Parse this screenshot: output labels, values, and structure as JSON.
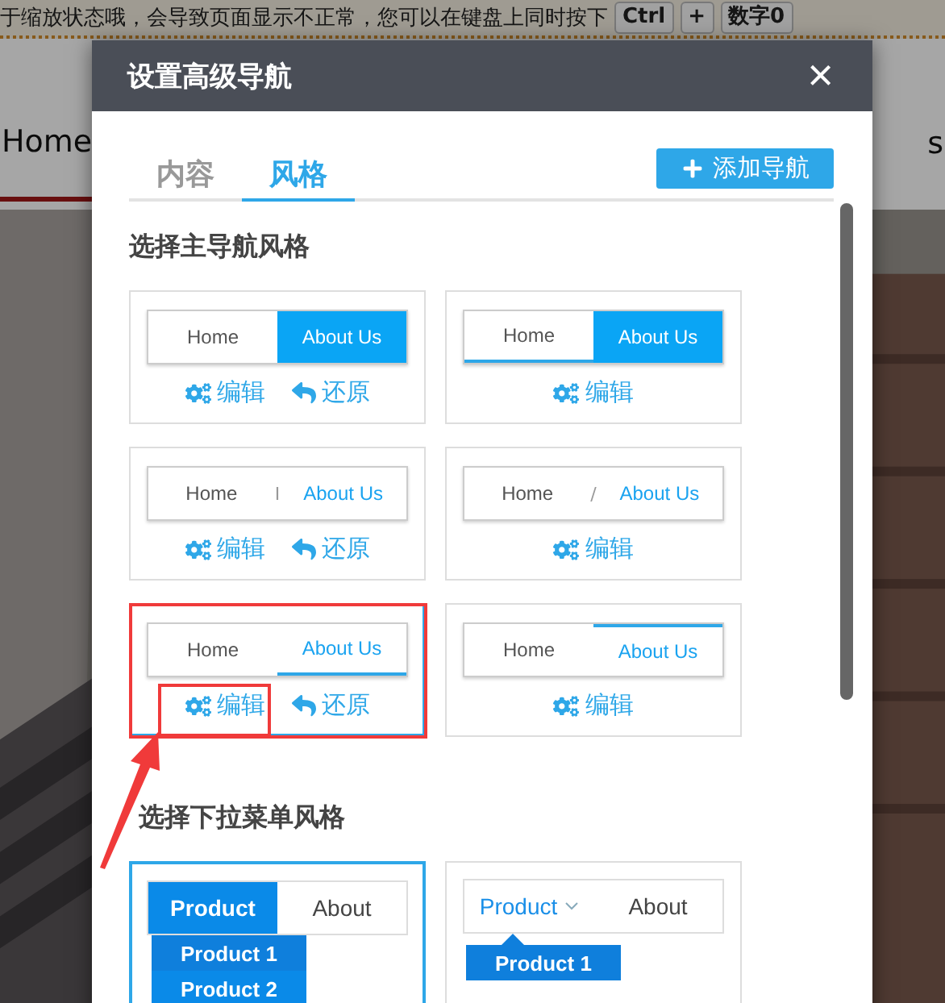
{
  "notice": {
    "text": "于缩放状态哦，会导致页面显示不正常，您可以在键盘上同时按下",
    "keys": [
      "Ctrl",
      "+",
      "数字0"
    ]
  },
  "page_nav": {
    "items": [
      "Home",
      "s"
    ]
  },
  "modal": {
    "title": "设置高级导航",
    "close": "×",
    "tabs": [
      {
        "label": "内容",
        "selected": false
      },
      {
        "label": "风格",
        "selected": true
      }
    ],
    "add_button": "添加导航",
    "nav_section": {
      "title": "选择主导航风格",
      "styles": [
        {
          "kind": "filled",
          "items": [
            "Home",
            "About Us"
          ],
          "selected": false,
          "actions": [
            {
              "kind": "edit",
              "label": "编辑"
            },
            {
              "kind": "restore",
              "label": "还原"
            }
          ]
        },
        {
          "kind": "filled-underline",
          "items": [
            "Home",
            "About Us"
          ],
          "selected": false,
          "actions": [
            {
              "kind": "edit",
              "label": "编辑"
            }
          ]
        },
        {
          "kind": "divider",
          "items": [
            "Home",
            "I",
            "About Us"
          ],
          "selected": false,
          "actions": [
            {
              "kind": "edit",
              "label": "编辑"
            },
            {
              "kind": "restore",
              "label": "还原"
            }
          ]
        },
        {
          "kind": "slash",
          "items": [
            "Home",
            "/",
            "About Us"
          ],
          "selected": false,
          "actions": [
            {
              "kind": "edit",
              "label": "编辑"
            }
          ]
        },
        {
          "kind": "underline",
          "items": [
            "Home",
            "About Us"
          ],
          "selected": true,
          "actions": [
            {
              "kind": "edit",
              "label": "编辑"
            },
            {
              "kind": "restore",
              "label": "还原"
            }
          ]
        },
        {
          "kind": "topline",
          "items": [
            "Home",
            "About Us"
          ],
          "selected": false,
          "actions": [
            {
              "kind": "edit",
              "label": "编辑"
            }
          ]
        }
      ]
    },
    "dropdown_section": {
      "title": "选择下拉菜单风格",
      "styles": [
        {
          "kind": "block",
          "items": [
            "Product",
            "About"
          ],
          "submenu": [
            "Product 1",
            "Product 2"
          ],
          "selected": true
        },
        {
          "kind": "caret",
          "items": [
            "Product",
            "About"
          ],
          "submenu": [
            "Product 1"
          ],
          "selected": false
        }
      ]
    }
  }
}
